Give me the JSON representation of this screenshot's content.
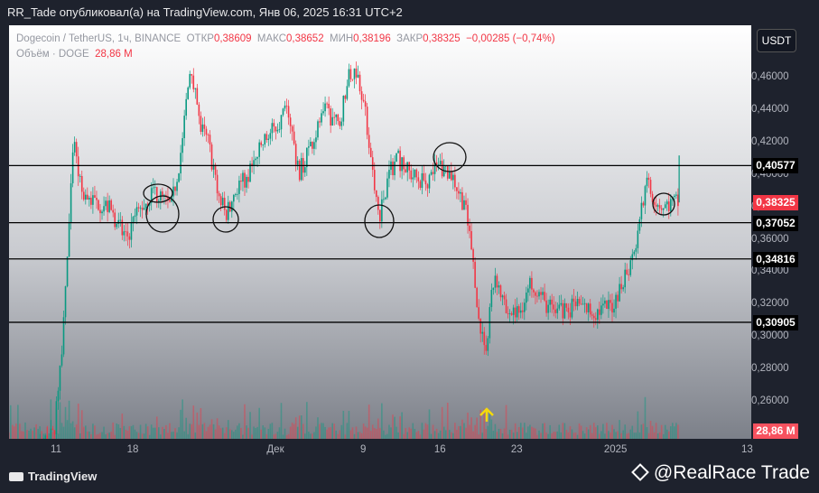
{
  "header": {
    "publisher": "RR_Tade опубликовал(а) на TradingView.com, Янв 06, 2025 16:31 UTC+2"
  },
  "legend": {
    "symbol": "Dogecoin / TetherUS, 1ч, BINANCE",
    "open_label": "ОТКР",
    "open": "0,38609",
    "high_label": "МАКС",
    "high": "0,38652",
    "low_label": "МИН",
    "low": "0,38196",
    "close_label": "ЗАКР",
    "close": "0,38325",
    "change": "−0,00285 (−0,74%)",
    "volume_label": "Объём · DOGE",
    "volume": "28,86 M"
  },
  "currency": "USDT",
  "watermark": {
    "logo": "TradingView",
    "credit": "@RealRace Trade"
  },
  "chart_data": {
    "type": "candlestick",
    "title": "Dogecoin / TetherUS, 1ч, BINANCE",
    "ylim": [
      0.237,
      0.487
    ],
    "y_ticks": [
      "0,46000",
      "0,44000",
      "0,42000",
      "0,40000",
      "0,38000",
      "0,36000",
      "0,34000",
      "0,32000",
      "0,30000",
      "0,28000",
      "0,26000"
    ],
    "y_tick_values": [
      0.46,
      0.44,
      0.42,
      0.4,
      0.38,
      0.36,
      0.34,
      0.32,
      0.3,
      0.28,
      0.26
    ],
    "x_ticks": [
      "11",
      "18",
      "Дек",
      "9",
      "16",
      "23",
      "2025",
      "13"
    ],
    "x_tick_days": [
      0,
      7,
      20,
      28,
      35,
      42,
      51,
      63
    ],
    "price_path_days": [
      -4.3,
      -0.2,
      0.6,
      1.3,
      1.6,
      2.3,
      3.1,
      4.8,
      6.4,
      7.3,
      8.9,
      10.5,
      11.3,
      12.3,
      13.1,
      13.9,
      14.7,
      15.5,
      16.3,
      17.6,
      18.9,
      20.1,
      21.2,
      22.1,
      23.3,
      24.6,
      25.8,
      26.6,
      27.4,
      28.2,
      28.8,
      29.5,
      30.3,
      31.1,
      32.4,
      33.6,
      34.8,
      36.1,
      37.3,
      37.9,
      38.5,
      39.1,
      40.0,
      41.0,
      42.2,
      43.4,
      44.6,
      45.9,
      47.5,
      49.1,
      50.8,
      51.9,
      52.7,
      53.3,
      53.9,
      54.6,
      55.4,
      56.2,
      56.8
    ],
    "price_path": [
      0.215,
      0.24,
      0.3,
      0.38,
      0.42,
      0.39,
      0.385,
      0.38,
      0.36,
      0.375,
      0.39,
      0.38,
      0.41,
      0.47,
      0.43,
      0.42,
      0.39,
      0.375,
      0.39,
      0.4,
      0.42,
      0.43,
      0.44,
      0.4,
      0.42,
      0.44,
      0.43,
      0.46,
      0.465,
      0.44,
      0.4,
      0.375,
      0.4,
      0.41,
      0.4,
      0.395,
      0.405,
      0.4,
      0.38,
      0.35,
      0.31,
      0.29,
      0.34,
      0.315,
      0.315,
      0.335,
      0.32,
      0.315,
      0.32,
      0.315,
      0.32,
      0.34,
      0.35,
      0.38,
      0.395,
      0.385,
      0.38,
      0.383,
      0.383
    ],
    "last_price": 0.38325,
    "horizontal_levels": [
      0.40577,
      0.37052,
      0.34816,
      0.30905
    ],
    "level_labels": [
      "0,40577",
      "0,37052",
      "0,34816",
      "0,30905"
    ],
    "last_price_label": "0,38325",
    "volume_label": "28,86 M",
    "colors": {
      "up": "#089981",
      "down": "#f23645",
      "level": "#000000"
    }
  }
}
